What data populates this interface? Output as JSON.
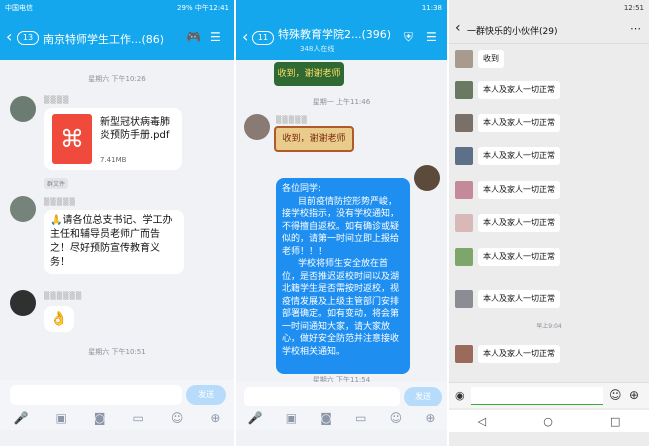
{
  "panel1": {
    "status_left": "中国电信",
    "status_right": "29% 中午12:41",
    "back_count": "13",
    "title": "南京特师学生工作...(86)",
    "time1": "星期六 下午10:26",
    "file_name": "新型冠状病毒肺炎预防手册.pdf",
    "file_size": "7.41MB",
    "file_tag": "群文件",
    "notice": "请各位总支书记、学工办主任和辅导员老师广而告之！尽好预防宣传教育义务！",
    "time2": "星期六 下午10:51",
    "send": "发送"
  },
  "panel2": {
    "status_right": "11:38",
    "back_count": "11",
    "title": "特殊教育学院2...(396)",
    "online": "348人在线",
    "sticker1": "收到，谢谢老师",
    "time1": "星期一 上午11:46",
    "sticker2": "收到，谢谢老师",
    "msg_greet": "各位同学:",
    "msg_p1": "目前疫情防控形势严峻，接学校指示，没有学校通知，不得擅自返校。如有确诊或疑似的，请第一时间立即上报给老师！！！",
    "msg_p2": "学校将师生安全放在首位，是否推迟返校时间以及湖北籍学生是否需按时返校，视疫情发展及上级主管部门安排部署确定。如有变动，将会第一时间通知大家，请大家放心，做好安全防范并注意接收学校相关通知。",
    "time2": "星期六 下午11:54",
    "send": "发送"
  },
  "panel3": {
    "status_right": "12:51",
    "title": "一群快乐的小伙伴(29)",
    "first_msg": "收到",
    "msgs": [
      "本人及家人一切正常",
      "本人及家人一切正常",
      "本人及家人一切正常",
      "本人及家人一切正常",
      "本人及家人一切正常",
      "本人及家人一切正常",
      "本人及家人一切正常",
      "本人及家人一切正常"
    ],
    "time1": "早上9:04"
  }
}
